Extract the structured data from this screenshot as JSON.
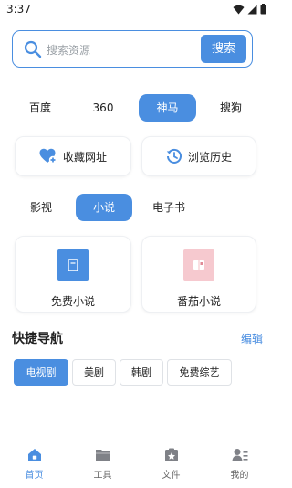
{
  "status_bar": {
    "time": "3:37"
  },
  "search": {
    "placeholder": "搜索资源",
    "button_label": "搜索"
  },
  "engines": [
    {
      "label": "百度",
      "active": false
    },
    {
      "label": "360",
      "active": false
    },
    {
      "label": "神马",
      "active": true
    },
    {
      "label": "搜狗",
      "active": false
    }
  ],
  "actions": {
    "favorites_label": "收藏网址",
    "history_label": "浏览历史"
  },
  "categories": [
    {
      "label": "影视",
      "active": false
    },
    {
      "label": "小说",
      "active": true
    },
    {
      "label": "电子书",
      "active": false
    }
  ],
  "books": [
    {
      "label": "免费小说",
      "color": "#4a8ee0",
      "icon": "book-icon"
    },
    {
      "label": "番茄小说",
      "color": "#f6c9cf",
      "icon": "tomato-book-icon"
    }
  ],
  "shortcuts": {
    "title": "快捷导航",
    "edit_label": "编辑",
    "chips": [
      {
        "label": "电视剧",
        "active": true
      },
      {
        "label": "美剧",
        "active": false
      },
      {
        "label": "韩剧",
        "active": false
      },
      {
        "label": "免费综艺",
        "active": false
      }
    ]
  },
  "nav": [
    {
      "label": "首页",
      "icon": "home-icon",
      "active": true
    },
    {
      "label": "工具",
      "icon": "folder-icon",
      "active": false
    },
    {
      "label": "文件",
      "icon": "file-icon",
      "active": false
    },
    {
      "label": "我的",
      "icon": "profile-icon",
      "active": false
    }
  ],
  "colors": {
    "accent": "#4a8ee0",
    "heart": "#4a8ee0"
  }
}
